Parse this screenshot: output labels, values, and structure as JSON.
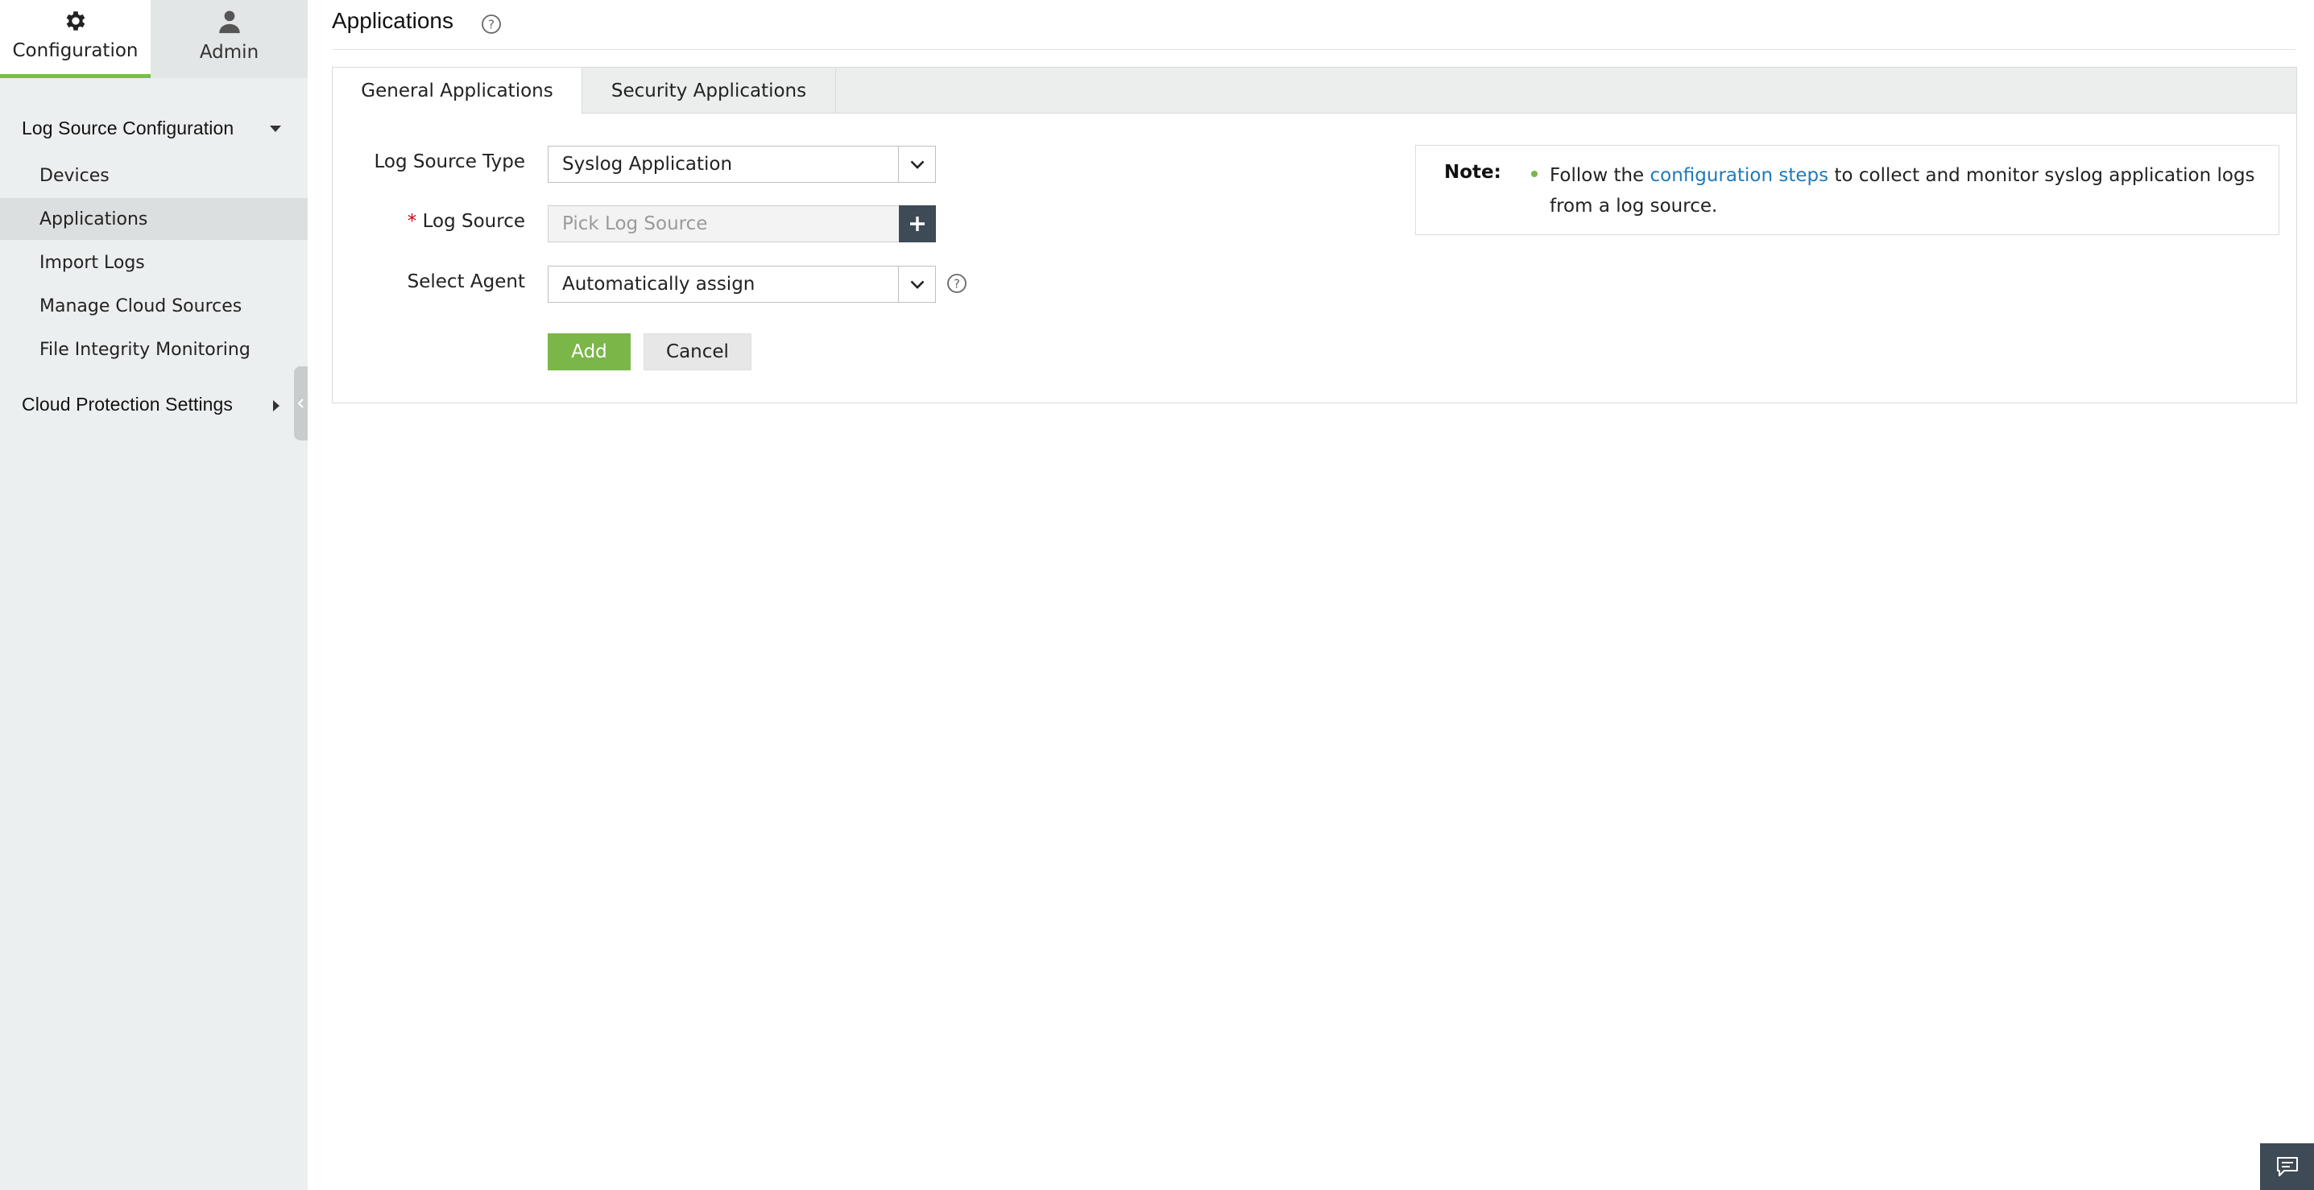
{
  "sidebar": {
    "top_tabs": [
      {
        "label": "Configuration",
        "icon": "gear-icon"
      },
      {
        "label": "Admin",
        "icon": "user-icon"
      }
    ],
    "sections": [
      {
        "label": "Log Source Configuration",
        "expanded": true
      },
      {
        "label": "Cloud Protection Settings",
        "expanded": false
      }
    ],
    "items": [
      {
        "label": "Devices"
      },
      {
        "label": "Applications",
        "selected": true
      },
      {
        "label": "Import Logs"
      },
      {
        "label": "Manage Cloud Sources"
      },
      {
        "label": "File Integrity Monitoring"
      }
    ]
  },
  "header": {
    "title": "Applications"
  },
  "tabs": [
    {
      "label": "General Applications",
      "active": true
    },
    {
      "label": "Security Applications",
      "active": false
    }
  ],
  "form": {
    "log_source_type": {
      "label": "Log Source Type",
      "value": "Syslog Application"
    },
    "log_source": {
      "required_mark": "*",
      "label": "Log Source",
      "placeholder": "Pick Log Source"
    },
    "select_agent": {
      "label": "Select Agent",
      "value": "Automatically assign"
    },
    "add_label": "Add",
    "cancel_label": "Cancel"
  },
  "note": {
    "label": "Note:",
    "text_before": "Follow the ",
    "link_text": "configuration steps",
    "text_after": " to collect and monitor syslog application logs from a log source."
  },
  "colors": {
    "accent_green": "#7ab648",
    "link_blue": "#1f7ab8",
    "dark_button": "#3e4a55",
    "required_red": "#d0021b"
  }
}
